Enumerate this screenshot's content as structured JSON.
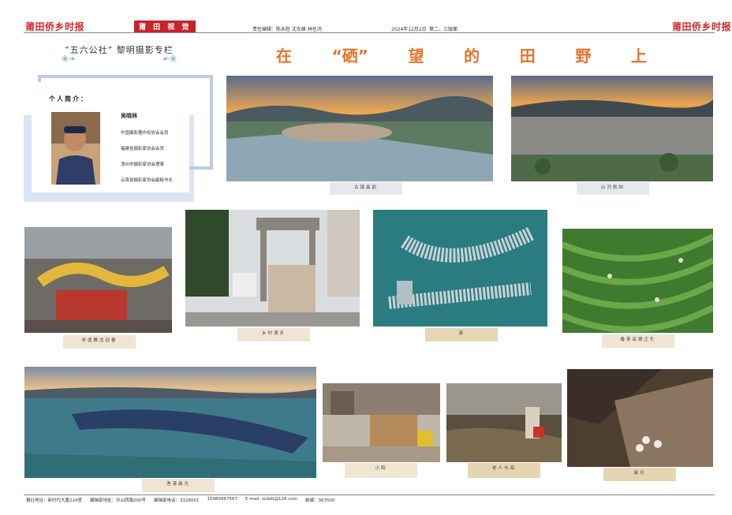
{
  "header": {
    "logo_left": "莆田侨乡时报",
    "logo_right": "莆田侨乡时报",
    "section_tag": "莆 田 视 觉",
    "editors": "责任编辑：陈永胜  沈东峰  林任鸿",
    "date": "2024年12月2日",
    "page": "第二、三版面"
  },
  "column": {
    "title": "“五六公社” 黎明摄影专栏"
  },
  "main_title": [
    "在",
    "“硒”",
    "望",
    "的",
    "田",
    "野",
    "上"
  ],
  "bio": {
    "heading": "个人简介：",
    "name": "吴晓林",
    "lines": [
      "中国摄影著作权协会会员",
      "福建省摄影家协会会员",
      "漳州市摄影家协会理事",
      "云霄县摄影家协会副秘书长"
    ]
  },
  "photos": {
    "p1": "古镇晨韵",
    "p2": "山河航拍",
    "p3": "非遗舞龙迎春",
    "p4": "乡村漫步",
    "p5": "港",
    "p6": "春茶采摘正忙",
    "p7": "渔港晨光",
    "p8": "小院",
    "p9": "老人与海",
    "p10": "晨光"
  },
  "footer": {
    "address": "报社地址：新时代大厦224室",
    "office": "编辑部地址：中山西路200号",
    "phone_label": "编辑部电话：",
    "phone": "3328001",
    "mobile": "15980967567",
    "email": "E-mail: zzdzb@126.com",
    "postcode": "邮编：363500"
  },
  "colors": {
    "brand_red": "#d6262b",
    "title_orange": "#e8732a",
    "frame_blue": "#b9cbe8"
  }
}
